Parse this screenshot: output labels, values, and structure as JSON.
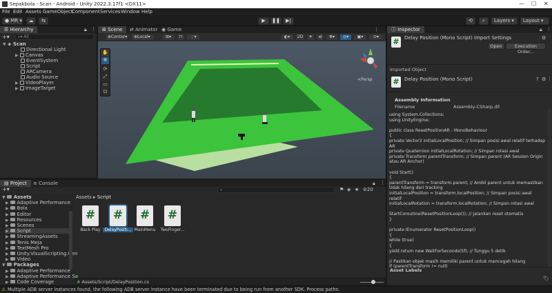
{
  "window": {
    "title": "Sepakbola - Scan - Android - Unity 2022.3.17f1 <DX11>"
  },
  "menu": [
    "File",
    "Edit",
    "Assets",
    "GameObject",
    "Component",
    "Services",
    "Window",
    "Help"
  ],
  "toolbar": {
    "account": "MR",
    "layers": "Layers",
    "layout": "Layout"
  },
  "hierarchy": {
    "tab": "Hierarchy",
    "search_placeholder": "All",
    "root": "Scan",
    "items": [
      "Directional Light",
      "Canvas",
      "EventSystem",
      "Script",
      "ARCamera",
      "Audio Source",
      "VideoPlayer",
      "ImageTarget"
    ]
  },
  "scene": {
    "tabs": [
      "Scene",
      "Animator",
      "Game"
    ],
    "pivot": "Center",
    "space": "Local",
    "mode2d": "2D",
    "persp": "<Persp"
  },
  "inspector": {
    "tab": "Inspector",
    "title": "Delay Position (Mono Script) Import Settings",
    "open_button": "Open",
    "exec_button": "Execution Order...",
    "imported_object": "Imported Object",
    "object_name": "Delay Position (Mono Script)",
    "assembly_header": "Assembly Information",
    "filename_label": "Filename",
    "filename_value": "Assembly-CSharp.dll",
    "code": [
      "using System.Collections;",
      "using UnityEngine;",
      "",
      "public class ResetPositionAR : MonoBehaviour",
      "{",
      "   private Vector3 initialLocalPosition; // Simpan posisi awal relatif terhadap",
      "AR",
      "   private Quaternion initialLocalRotation; // Simpan rotasi awal",
      "   private Transform parentTransform; // Simpan parent (AR Session Origin",
      "atau AR Anchor)",
      "",
      "   void Start()",
      "   {",
      "      parentTransform = transform.parent; // Ambil parent untuk memastikan",
      "tidak hilang dari tracking",
      "      initialLocalPosition = transform.localPosition; // Simpan posisi awal",
      "relatif",
      "      initialLocalRotation = transform.localRotation; // Simpan rotasi awal",
      "",
      "      StartCoroutine(ResetPositionLoop()); // Jalankan reset otomatis",
      "   }",
      "",
      "   private IEnumerator ResetPositionLoop()",
      "   {",
      "      while (true)",
      "      {",
      "         yield return new WaitForSeconds(5f); // Tunggu 5 detik",
      "",
      "         // Pastikan objek masih memiliki parent untuk mencegah hilang",
      "         if (parentTransform != null)"
    ],
    "asset_labels": "Asset Labels"
  },
  "project": {
    "tabs": [
      "Project",
      "Console"
    ],
    "add": "+",
    "tree": [
      {
        "label": "Assets",
        "level": 0,
        "bold": true
      },
      {
        "label": "Adaptive Performance",
        "level": 1
      },
      {
        "label": "Bola",
        "level": 1
      },
      {
        "label": "Editor",
        "level": 1
      },
      {
        "label": "Resources",
        "level": 1
      },
      {
        "label": "Scenes",
        "level": 1
      },
      {
        "label": "Script",
        "level": 1,
        "selected": true
      },
      {
        "label": "StreamingAssets",
        "level": 1
      },
      {
        "label": "Tenis Meja",
        "level": 1
      },
      {
        "label": "TextMesh Pro",
        "level": 1
      },
      {
        "label": "Unity.VisualScripting.Gen",
        "level": 1
      },
      {
        "label": "Video",
        "level": 1
      },
      {
        "label": "Packages",
        "level": 0,
        "bold": true
      },
      {
        "label": "Adaptive Performance",
        "level": 1
      },
      {
        "label": "Adaptive Performance Sa",
        "level": 1
      },
      {
        "label": "Code Coverage",
        "level": 1
      }
    ],
    "breadcrumb": [
      "Assets",
      "Script"
    ],
    "badge": "20",
    "assets": [
      {
        "label": "Back Play"
      },
      {
        "label": "DelayPositi...",
        "selected": true
      },
      {
        "label": "MainMenu"
      },
      {
        "label": "TwoFinger..."
      }
    ],
    "path": "Assets/Script/DelayPosition.cs"
  },
  "status": {
    "message": "Multiple ADB server instances found, the following ADB server instance have been terminated due to being run from another SDK. Process paths:"
  },
  "colors": {
    "accent": "#2c5d87",
    "field_green": "#3cc43c",
    "dark_green": "#267a2e"
  }
}
